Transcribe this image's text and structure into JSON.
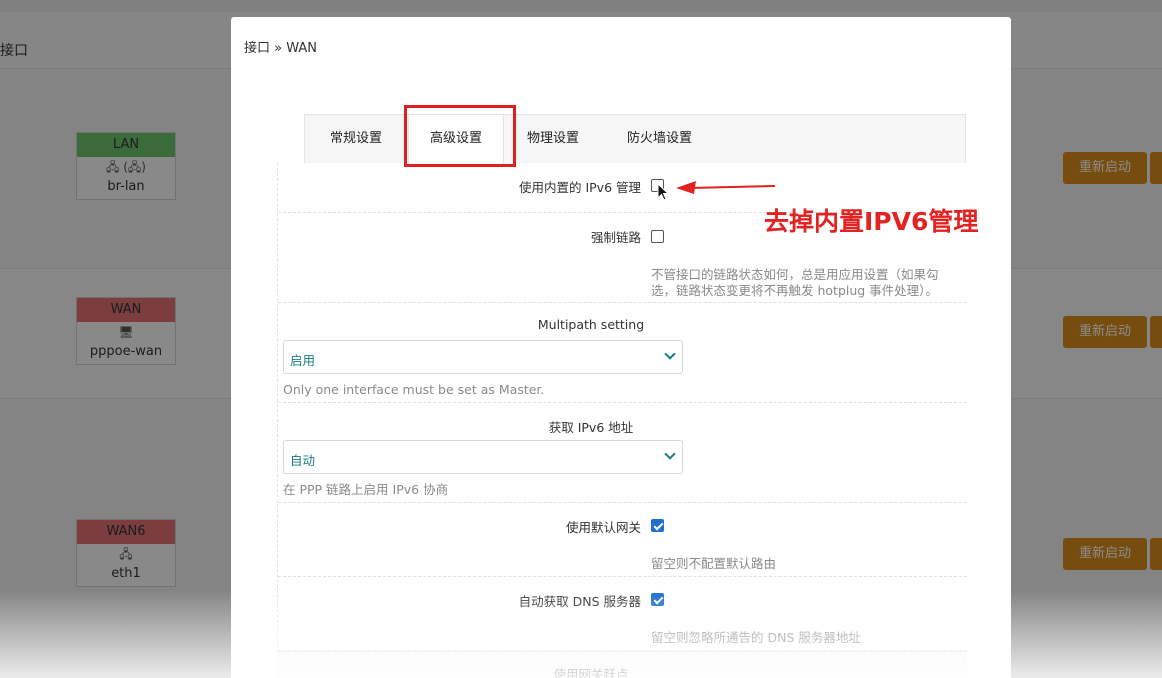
{
  "background": {
    "title": "接口",
    "interfaces": [
      {
        "label": "LAN",
        "color": "#5cb85c",
        "icons": "🖧 (🖧)",
        "name": "br-lan"
      },
      {
        "label": "WAN",
        "color": "#d9534f",
        "icons": "🖥",
        "name": "pppoe-wan"
      },
      {
        "label": "WAN6",
        "color": "#d9534f",
        "icons": "🖧",
        "name": "eth1"
      }
    ],
    "restart_label": "重新启动"
  },
  "modal": {
    "breadcrumb": "接口 » WAN",
    "tabs": [
      {
        "label": "常规设置"
      },
      {
        "label": "高级设置"
      },
      {
        "label": "物理设置"
      },
      {
        "label": "防火墙设置"
      }
    ],
    "fields": {
      "builtin_ipv6": {
        "label": "使用内置的 IPv6 管理",
        "checked": false
      },
      "force_link": {
        "label": "强制链路",
        "checked": false,
        "help": "不管接口的链路状态如何，总是用应用设置（如果勾选，链路状态变更将不再触发 hotplug 事件处理）。"
      },
      "multipath": {
        "label": "Multipath setting",
        "value": "启用",
        "help": "Only one interface must be set as Master."
      },
      "ipv6_addr": {
        "label": "获取 IPv6 地址",
        "value": "自动",
        "help": "在 PPP 链路上启用 IPv6 协商"
      },
      "default_gw": {
        "label": "使用默认网关",
        "checked": true,
        "help": "留空则不配置默认路由"
      },
      "auto_dns": {
        "label": "自动获取 DNS 服务器",
        "checked": true,
        "help": "留空则忽略所通告的 DNS 服务器地址"
      },
      "gw_metric": {
        "label": "使用网关跃点"
      }
    }
  },
  "annotation": {
    "text": "去掉内置IPV6管理",
    "color": "#e32222"
  }
}
